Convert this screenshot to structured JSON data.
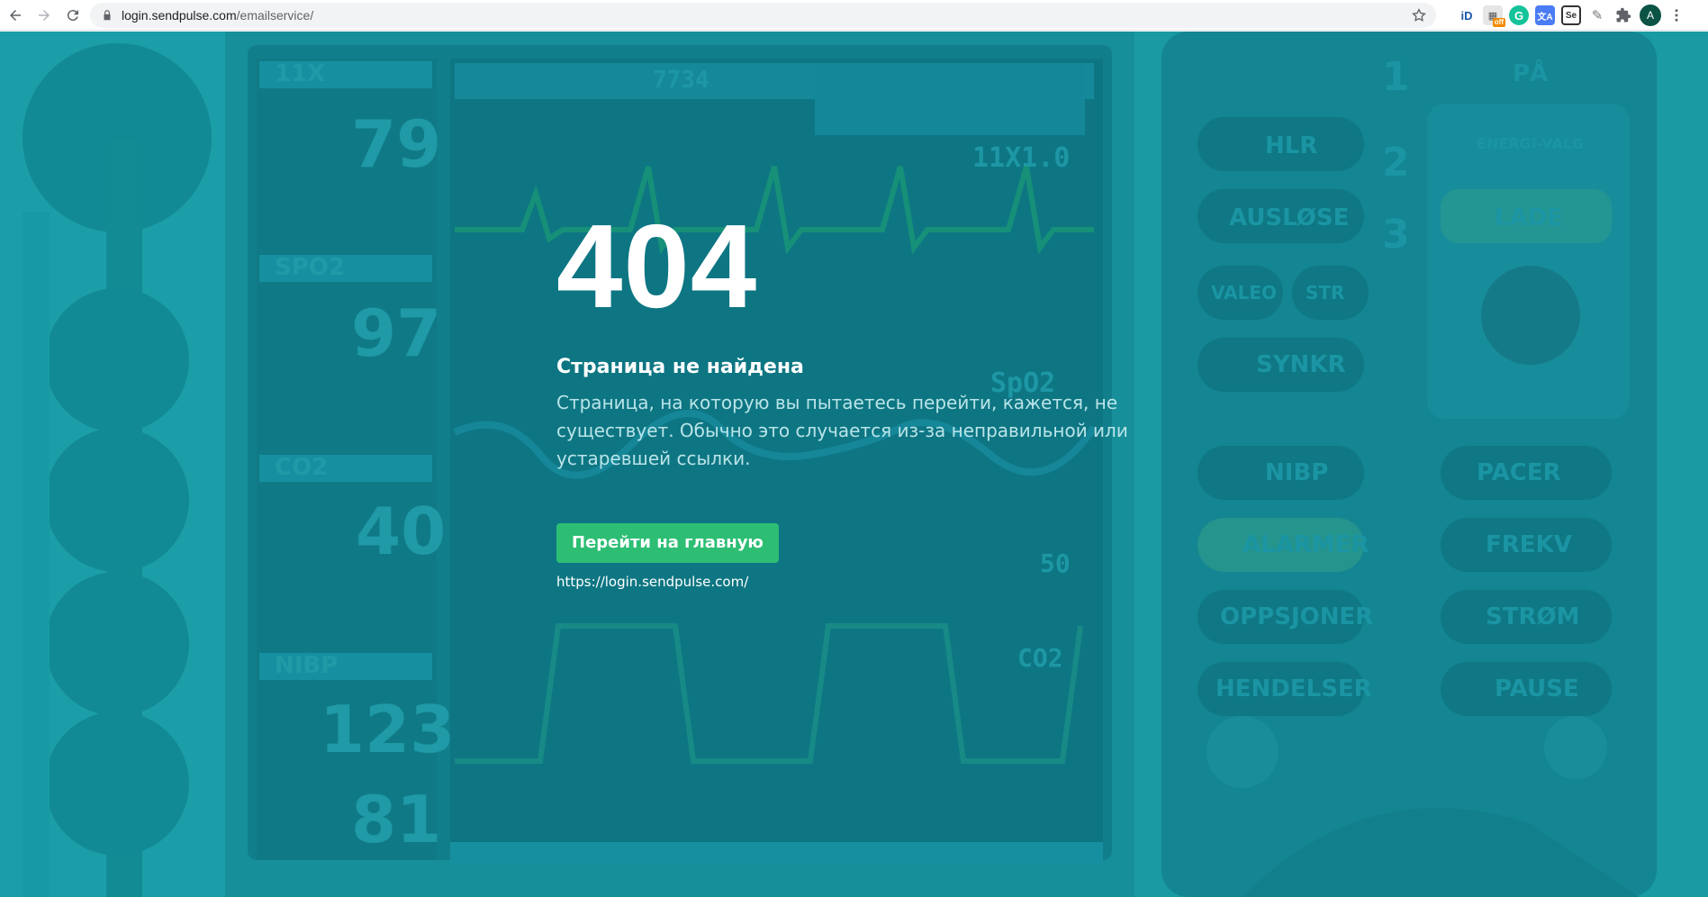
{
  "browser": {
    "url_host": "login.sendpulse.com",
    "url_path": "/emailservice/",
    "extensions": {
      "id_label": "iD",
      "off_badge": "off",
      "grammarly_label": "G",
      "translate_label": "文A",
      "se_label": "Se",
      "avatar_letter": "A"
    }
  },
  "background": {
    "monitor_labels": [
      "11X",
      "SPO2",
      "CO2",
      "NIBP",
      "7734",
      "11X1.0",
      "SpO2",
      "50",
      "CO2"
    ],
    "monitor_values": [
      "79",
      "97",
      "40",
      "123",
      "81"
    ],
    "panel_buttons": [
      "HLR",
      "AUSLØSE",
      "VALEO",
      "STR",
      "SYNKR",
      "NIBP",
      "ALARMER",
      "OPPSJONER",
      "HENDELSER",
      "PACER",
      "FREKV",
      "STRØM",
      "PAUSE",
      "ENERGI-VALG",
      "LADE",
      "PÅ"
    ],
    "panel_numbers": [
      "1",
      "2",
      "3"
    ]
  },
  "error_page": {
    "code": "404",
    "title": "Страница не найдена",
    "description": "Страница, на которую вы пытаетесь перейти, кажется, не существует. Обычно это случается из-за неправильной или устаревшей ссылки.",
    "button_label": "Перейти на главную",
    "home_url": "https://login.sendpulse.com/"
  },
  "colors": {
    "overlay": "#1a9aa3",
    "button": "#2dbe74",
    "text": "#ffffff",
    "muted_text": "#b9e4e8"
  }
}
